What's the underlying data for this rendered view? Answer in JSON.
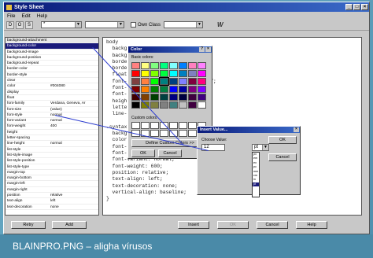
{
  "window": {
    "title": "Style Sheet",
    "min": "_",
    "max": "□",
    "close": "×"
  },
  "menu": [
    "File",
    "Edit",
    "Help"
  ],
  "toolbar": {
    "selector_value": "*",
    "own_class_label": "Own Class",
    "wizard_label": "W",
    "tools": [
      "D",
      "O",
      "S"
    ]
  },
  "selected_property": "background-attachment",
  "properties": [
    {
      "name": "background-color",
      "value": ""
    },
    {
      "name": "background-image",
      "value": ""
    },
    {
      "name": "background-position",
      "value": ""
    },
    {
      "name": "background-repeat",
      "value": ""
    },
    {
      "name": "border-color",
      "value": ""
    },
    {
      "name": "border-style",
      "value": ""
    },
    {
      "name": "clear",
      "value": ""
    },
    {
      "name": "color",
      "value": "#004080"
    },
    {
      "name": "display",
      "value": ""
    },
    {
      "name": "float",
      "value": ""
    },
    {
      "name": "font-family",
      "value": "Verdana, Geneva, Ar"
    },
    {
      "name": "font-size",
      "value": "(value)"
    },
    {
      "name": "font-style",
      "value": "normal"
    },
    {
      "name": "font-variant",
      "value": "normal"
    },
    {
      "name": "font-weight",
      "value": "400"
    },
    {
      "name": "height",
      "value": ""
    },
    {
      "name": "letter-spacing",
      "value": ""
    },
    {
      "name": "line-height",
      "value": "normal"
    },
    {
      "name": "list-style",
      "value": ""
    },
    {
      "name": "list-style-image",
      "value": ""
    },
    {
      "name": "list-style-position",
      "value": ""
    },
    {
      "name": "list-style-type",
      "value": ""
    },
    {
      "name": "margin-top",
      "value": ""
    },
    {
      "name": "margin-bottom",
      "value": ""
    },
    {
      "name": "margin-left",
      "value": ""
    },
    {
      "name": "margin-right",
      "value": ""
    },
    {
      "name": "position",
      "value": "relative"
    },
    {
      "name": "text-align",
      "value": "left"
    },
    {
      "name": "text-decoration",
      "value": "none"
    }
  ],
  "editor_lines": [
    "body",
    "  backg",
    "  backg",
    "  borde",
    "  borde",
    "  float",
    "  font-                    ans-serif;",
    "  font-",
    "  font-",
    "  heigh",
    "  lette",
    "  line-",
    "",
    ".syntax",
    "  backg",
    "  color",
    "  font-",
    "  font-style: normal;",
    "  font-variant: normal;",
    "  font-weight: 600;",
    "  position: relative;",
    "  text-align: left;",
    "  text-decoration: none;",
    "  vertical-align: baseline;",
    "}"
  ],
  "color_dialog": {
    "title": "Color",
    "help": "?",
    "close": "×",
    "basic_label": "Basic colors:",
    "custom_label": "Custom colors:",
    "define_label": "Define Custom Colors >>",
    "ok": "OK",
    "cancel": "Cancel",
    "basic_colors": [
      "#ff8080",
      "#ffff80",
      "#80ff80",
      "#00ff80",
      "#80ffff",
      "#0080ff",
      "#ff80c0",
      "#ff80ff",
      "#ff0000",
      "#ffff00",
      "#80ff00",
      "#00ff40",
      "#00ffff",
      "#0080c0",
      "#8080c0",
      "#ff00ff",
      "#804040",
      "#ff8040",
      "#00ff00",
      "#008080",
      "#004080",
      "#8080ff",
      "#800040",
      "#ff0080",
      "#800000",
      "#ff8000",
      "#008000",
      "#008040",
      "#0000ff",
      "#0000a0",
      "#800080",
      "#8000ff",
      "#400000",
      "#804000",
      "#004000",
      "#004040",
      "#000080",
      "#000040",
      "#400040",
      "#400080",
      "#000000",
      "#808000",
      "#808040",
      "#808080",
      "#408080",
      "#c0c0c0",
      "#400040",
      "#ffffff"
    ]
  },
  "insert_dialog": {
    "title": "Insert Value...",
    "close": "×",
    "choose_label": "Choose Value:",
    "value": "12",
    "unit": "pt",
    "ok": "OK",
    "cancel": "Cancel",
    "units": [
      "px",
      "em",
      "ex",
      "pc",
      "mm",
      "cm",
      "in",
      "pt"
    ],
    "selected_unit": "pt"
  },
  "bottom_buttons": {
    "retry": "Retry",
    "add": "Add",
    "insert": "Insert",
    "ok": "OK",
    "cancel": "Cancel",
    "help": "Help"
  },
  "caption": "BLAINPRO.PNG – aligha vírusos"
}
